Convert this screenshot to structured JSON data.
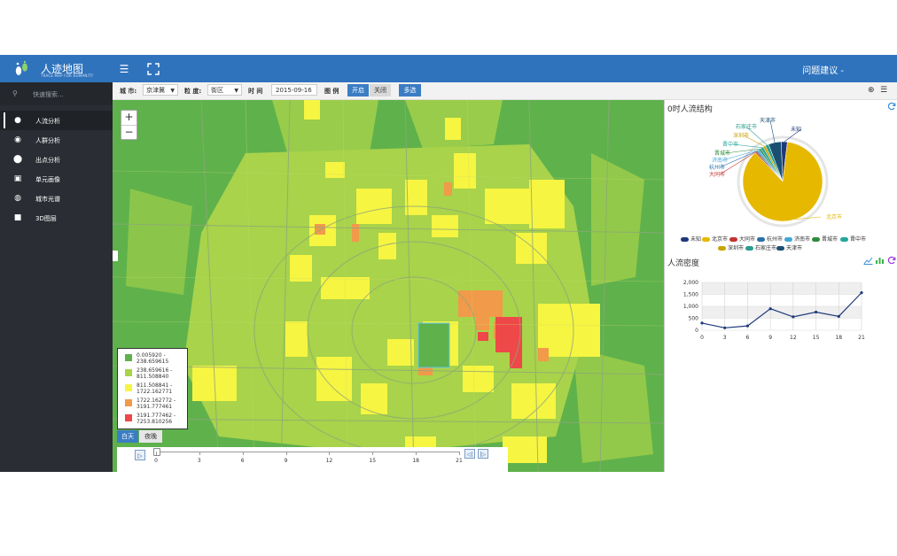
{
  "app": {
    "title": "人迹地图",
    "subtitle": "TRACE MAP FOR HUMANITY",
    "feedback": "问题建议 -",
    "brand_color": "#2f73bd"
  },
  "sidebar": {
    "search_placeholder": "快速搜索...",
    "items": [
      {
        "label": "人流分析",
        "icon": "user-icon",
        "active": true
      },
      {
        "label": "人群分析",
        "icon": "eye-icon",
        "active": false
      },
      {
        "label": "出点分析",
        "icon": "map-pin-icon",
        "active": false
      },
      {
        "label": "单元画像",
        "icon": "image-icon",
        "active": false
      },
      {
        "label": "城市光谱",
        "icon": "globe-icon",
        "active": false
      },
      {
        "label": "3D图层",
        "icon": "video-icon",
        "active": false
      }
    ]
  },
  "filters": {
    "city_label": "城 市:",
    "city_value": "京津冀",
    "granularity_label": "粒 度:",
    "granularity_value": "街区",
    "time_label": "时 间",
    "time_value": "2015-09-16",
    "legend_label": "图 例",
    "legend_on": "开启",
    "legend_off": "关闭",
    "multi_select": "多选"
  },
  "map": {
    "zoom_in": "+",
    "zoom_out": "−",
    "legend": [
      {
        "range": "0.005920 - 238.659615",
        "color": "#5fb14c"
      },
      {
        "range": "238.659616 - 811.508840",
        "color": "#a8d34a"
      },
      {
        "range": "811.508841 - 1722.162771",
        "color": "#f6f542"
      },
      {
        "range": "1722.162772 - 3191.777461",
        "color": "#f19a4a"
      },
      {
        "range": "3191.777462 - 7253.810256",
        "color": "#ee4848"
      }
    ],
    "day_label": "白天",
    "night_label": "夜晚",
    "timeline_ticks": [
      "0",
      "3",
      "6",
      "9",
      "12",
      "15",
      "18",
      "21"
    ],
    "timeline_value": 0
  },
  "panel": {
    "structure_title": "0时人流结构",
    "density_title": "人流密度"
  },
  "chart_data": [
    {
      "type": "pie",
      "title": "0时人流结构",
      "slice_labels_on_chart": [
        "天津市",
        "石家庄市",
        "深圳市",
        "晋中市",
        "晋城市",
        "济南市",
        "杭州市",
        "大同市",
        "未知",
        "北京市"
      ],
      "legend": [
        "未知",
        "北京市",
        "大同市",
        "杭州市",
        "济南市",
        "晋城市",
        "晋中市",
        "深圳市",
        "石家庄市",
        "天津市"
      ],
      "series": [
        {
          "name": "北京市",
          "value": 86.0,
          "color": "#e6b800"
        },
        {
          "name": "未知",
          "value": 2.5,
          "color": "#1f3a7a"
        },
        {
          "name": "大同市",
          "value": 0.6,
          "color": "#c23531"
        },
        {
          "name": "杭州市",
          "value": 0.6,
          "color": "#2c6fa8"
        },
        {
          "name": "济南市",
          "value": 0.7,
          "color": "#3fa7d6"
        },
        {
          "name": "晋城市",
          "value": 0.8,
          "color": "#2f8b3d"
        },
        {
          "name": "晋中市",
          "value": 1.2,
          "color": "#26a69a"
        },
        {
          "name": "深圳市",
          "value": 1.0,
          "color": "#c9a300"
        },
        {
          "name": "石家庄市",
          "value": 1.4,
          "color": "#2a9d8f"
        },
        {
          "name": "天津市",
          "value": 5.2,
          "color": "#1b4f72"
        }
      ]
    },
    {
      "type": "line",
      "title": "人流密度",
      "x": [
        0,
        3,
        6,
        9,
        12,
        15,
        18,
        21
      ],
      "series": [
        {
          "values": [
            300,
            100,
            180,
            900,
            560,
            760,
            580,
            1570
          ],
          "color": "#1f3a7a"
        }
      ],
      "ylim": [
        0,
        2000
      ],
      "yticks": [
        "0",
        "500",
        "1,000",
        "1,500",
        "2,000"
      ],
      "grid": true,
      "legend": "none"
    }
  ]
}
